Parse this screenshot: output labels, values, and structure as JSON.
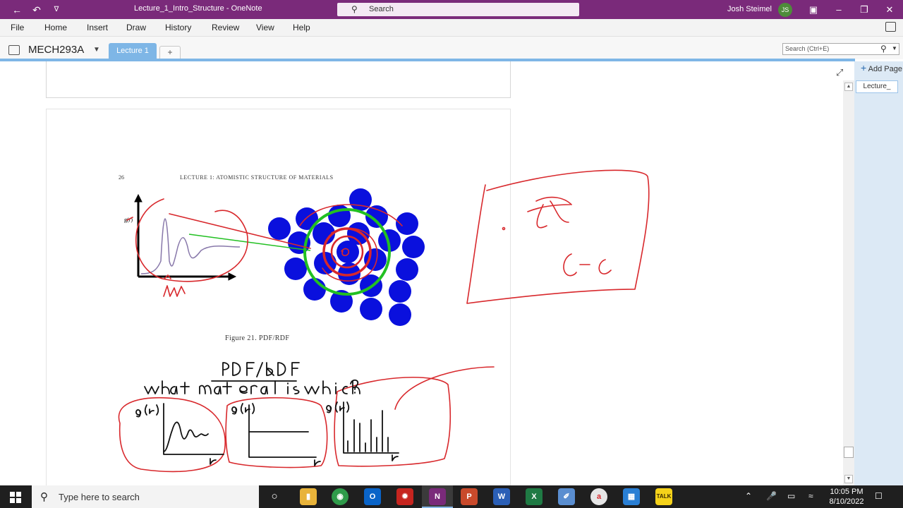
{
  "window": {
    "title": "Lecture_1_Intro_Structure  -  OneNote",
    "search_label": "Search",
    "user_name": "Josh Steimel",
    "user_initials": "JS"
  },
  "ribbon": {
    "menus": [
      "File",
      "Home",
      "Insert",
      "Draw",
      "History",
      "Review",
      "View",
      "Help"
    ]
  },
  "notebook": {
    "name": "MECH293A",
    "tab_label": "Lecture 1",
    "add_tab_label": "+",
    "search_placeholder": "Search (Ctrl+E)"
  },
  "page": {
    "page_number": "26",
    "running_head": "LECTURE 1:  ATOMISTIC STRUCTURE OF MATERIALS",
    "figure_caption": "Figure 21. PDF/RDF"
  },
  "pages_panel": {
    "add_page_label": "Add Page",
    "items": [
      "Lecture_"
    ]
  },
  "taskbar": {
    "search_placeholder": "Type here to search",
    "time": "10:05 PM",
    "date": "8/10/2022",
    "apps": [
      "cortana",
      "file-explorer",
      "chrome",
      "outlook",
      "settings-app",
      "onenote",
      "powerpoint",
      "word",
      "excel",
      "paint-app",
      "app-a",
      "store",
      "kakaotalk"
    ]
  },
  "colors": {
    "title_bar": "#7a2a7a",
    "tab_active": "#7eb6e6",
    "ink_red": "#d8282c",
    "atom_blue": "#0a10dd",
    "green_circle": "#22c022"
  }
}
